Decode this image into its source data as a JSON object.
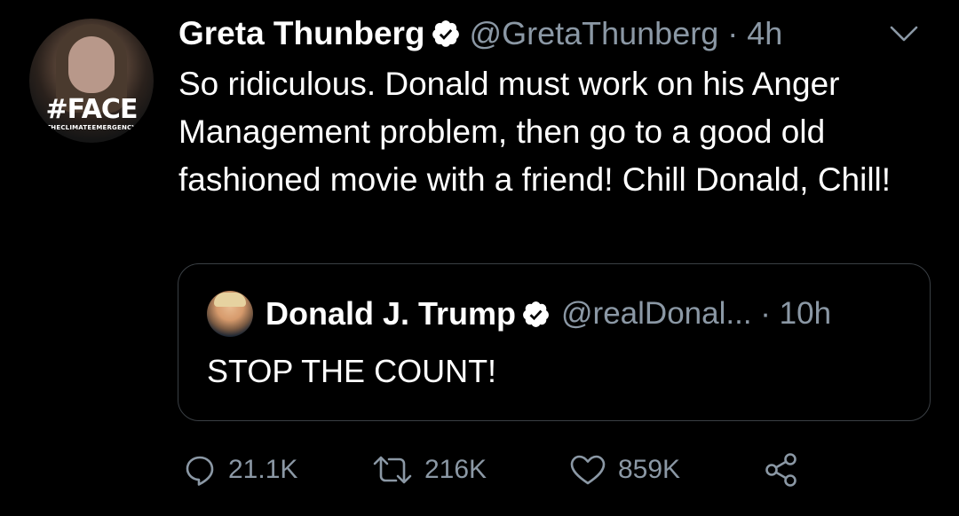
{
  "tweet": {
    "author": {
      "name": "Greta Thunberg",
      "handle": "@GretaThunberg",
      "time": "4h",
      "avatar": {
        "overlay_text": "#FACE",
        "overlay_subtext": "THECLIMATEEMERGENCY"
      },
      "verified_icon": "verified-badge-icon"
    },
    "separator": "·",
    "text": "So ridiculous. Donald must work on his Anger Management problem, then go to a good old fashioned movie with a friend! Chill Donald, Chill!",
    "menu_icon": "chevron-down-icon"
  },
  "quote": {
    "name": "Donald J. Trump",
    "handle": "@realDonal...",
    "separator": "·",
    "time": "10h",
    "text": "STOP THE COUNT!",
    "verified_icon": "verified-badge-icon"
  },
  "actions": {
    "reply": {
      "icon": "reply-bubble-icon",
      "count": "21.1K"
    },
    "retweet": {
      "icon": "retweet-icon",
      "count": "216K"
    },
    "like": {
      "icon": "heart-icon",
      "count": "859K"
    },
    "share": {
      "icon": "share-icon"
    }
  },
  "colors": {
    "background": "#000000",
    "text_primary": "#ffffff",
    "text_secondary": "#8b98a5",
    "border": "#3a3f44"
  }
}
